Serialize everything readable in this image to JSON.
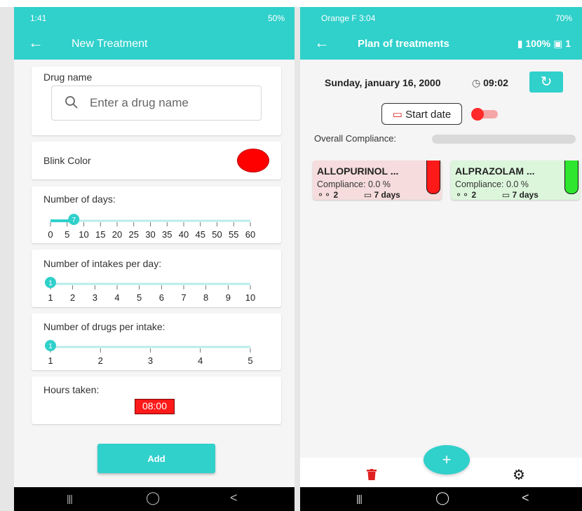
{
  "left": {
    "status": {
      "time": "1:41",
      "right": "50%"
    },
    "appbar": {
      "back": "←",
      "title": "New Treatment"
    },
    "drug_name": {
      "label": "Drug name",
      "placeholder": "Enter a drug name",
      "value": ""
    },
    "blink": {
      "label": "Blink Color",
      "color": "#ff0000"
    },
    "days": {
      "label": "Number of days:",
      "value": 7,
      "min": 0,
      "max": 60,
      "ticks": [
        "0",
        "5",
        "10",
        "15",
        "20",
        "25",
        "30",
        "35",
        "40",
        "45",
        "50",
        "55",
        "60"
      ]
    },
    "intakes": {
      "label": "Number of intakes per day:",
      "value": 1,
      "min": 1,
      "max": 10,
      "ticks": [
        "1",
        "2",
        "3",
        "4",
        "5",
        "6",
        "7",
        "8",
        "9",
        "10"
      ]
    },
    "drugs_per_intake": {
      "label": "Number of drugs per intake:",
      "value": 1,
      "min": 1,
      "max": 5,
      "ticks": [
        "1",
        "2",
        "3",
        "4",
        "5"
      ]
    },
    "hours": {
      "label": "Hours taken:",
      "value": "08:00"
    },
    "add_label": "Add",
    "nav": {
      "recents": "|||",
      "home": "◯",
      "back": "<"
    }
  },
  "right": {
    "status": {
      "time": "Orange F  3:04",
      "right": "70%"
    },
    "appbar": {
      "back": "←",
      "title": "Plan of treatments",
      "battery": "100%",
      "count": "1"
    },
    "date": "Sunday, january 16, 2000",
    "time": "09:02",
    "start_date_label": "Start date",
    "overall_label": "Overall Compliance:",
    "drugs": [
      {
        "name": "ALLOPURINOL ...",
        "compliance": "Compliance: 0.0 %",
        "pills": "2",
        "days": "7 days",
        "bg": "#f6dcdc",
        "vial": "#ff1a1a"
      },
      {
        "name": "ALPRAZOLAM ...",
        "compliance": "Compliance: 0.0 %",
        "pills": "2",
        "days": "7 days",
        "bg": "#dcf6dc",
        "vial": "#2ee62e"
      }
    ],
    "fab_label": "+",
    "nav": {
      "recents": "|||",
      "home": "◯",
      "back": "<"
    }
  },
  "colors": {
    "accent": "#30d0cb",
    "danger": "#ff1a1a"
  }
}
